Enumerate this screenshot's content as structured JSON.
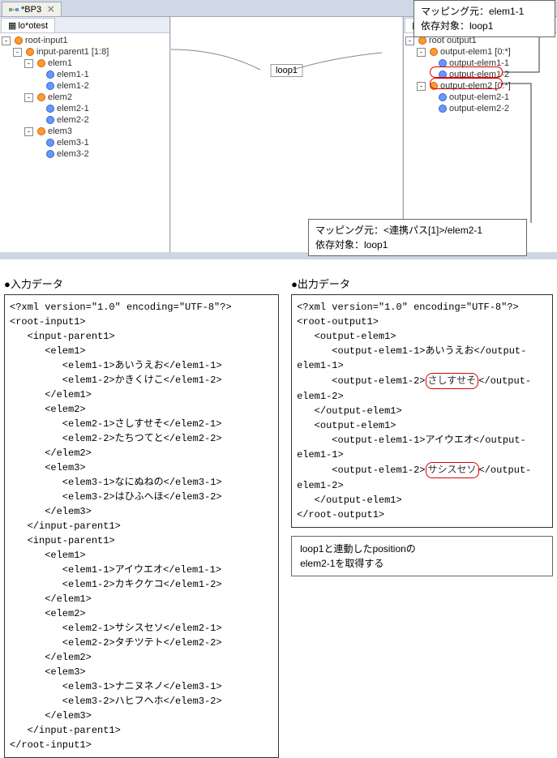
{
  "tab": {
    "label": "*BP3"
  },
  "leftPanel": {
    "tab": "lo*otest"
  },
  "rightPanel": {
    "tab": "lo*o"
  },
  "leftTree": {
    "root": "root-input1",
    "parent": "input-parent1 [1:8]",
    "items": [
      {
        "name": "elem1",
        "children": [
          "elem1-1",
          "elem1-2"
        ]
      },
      {
        "name": "elem2",
        "children": [
          "elem2-1",
          "elem2-2"
        ]
      },
      {
        "name": "elem3",
        "children": [
          "elem3-1",
          "elem3-2"
        ]
      }
    ]
  },
  "rightTree": {
    "root": "root output1",
    "groups": [
      {
        "name": "output-elem1 [0:*]",
        "children": [
          "output-elem1-1",
          "output-elem1-2"
        ]
      },
      {
        "name": "output-elem2 [0:*]",
        "children": [
          "output-elem2-1",
          "output-elem2-2"
        ]
      }
    ]
  },
  "loopLabel": "loop1",
  "callout1": {
    "line1": "マッピング元：elem1-1",
    "line2": "依存対象：loop1"
  },
  "callout2": {
    "line1": "マッピング元：<連携パス[1]>/elem2-1",
    "line2": "依存対象：loop1"
  },
  "inputTitle": "●入力データ",
  "outputTitle": "●出力データ",
  "xmlDecl": "<?xml version=\"1.0\" encoding=\"UTF-8\"?>",
  "inputXml": "<root-input1>\n   <input-parent1>\n      <elem1>\n         <elem1-1>あいうえお</elem1-1>\n         <elem1-2>かきくけこ</elem1-2>\n      </elem1>\n      <elem2>\n         <elem2-1>さしすせそ</elem2-1>\n         <elem2-2>たちつてと</elem2-2>\n      </elem2>\n      <elem3>\n         <elem3-1>なにぬねの</elem3-1>\n         <elem3-2>はひふへほ</elem3-2>\n      </elem3>\n   </input-parent1>\n   <input-parent1>\n      <elem1>\n         <elem1-1>アイウエオ</elem1-1>\n         <elem1-2>カキクケコ</elem1-2>\n      </elem1>\n      <elem2>\n         <elem2-1>サシスセソ</elem2-1>\n         <elem2-2>タチツテト</elem2-2>\n      </elem2>\n      <elem3>\n         <elem3-1>ナニヌネノ</elem3-1>\n         <elem3-2>ハヒフヘホ</elem3-2>\n      </elem3>\n   </input-parent1>\n</root-input1>",
  "outputXml": {
    "l1": "<root-output1>",
    "l2": "   <output-elem1>",
    "l3a": "      <output-elem1-1>あいうえお</output-",
    "l3b": "elem1-1>",
    "l4a": "      <output-elem1-2>",
    "l4v": "さしすせそ",
    "l4b": "</output-",
    "l4c": "elem1-2>",
    "l5": "   </output-elem1>",
    "l6": "   <output-elem1>",
    "l7a": "      <output-elem1-1>アイウエオ</output-",
    "l7b": "elem1-1>",
    "l8a": "      <output-elem1-2>",
    "l8v": "サシスセソ",
    "l8b": "</output-",
    "l8c": "elem1-2>",
    "l9": "   </output-elem1>",
    "l10": "</root-output1>"
  },
  "note": {
    "line1": "loop1と連動したpositionの",
    "line2": "elem2-1を取得する"
  }
}
